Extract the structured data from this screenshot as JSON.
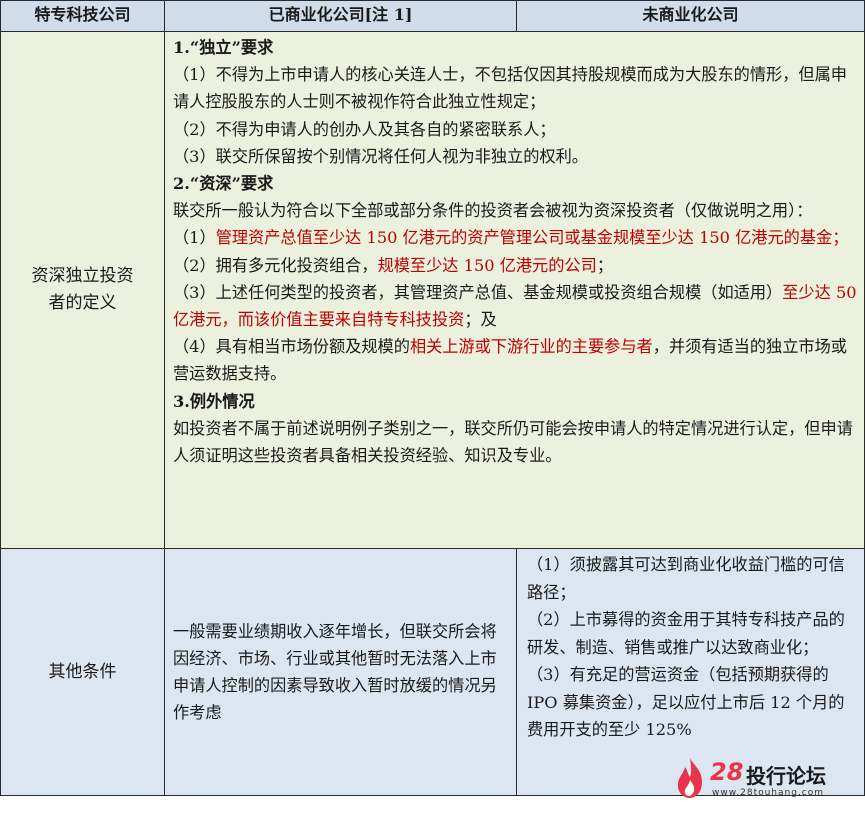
{
  "header": {
    "col1": "特专科技公司",
    "col2": "已商业化公司[注 1]",
    "col3": "未商业化公司"
  },
  "row1": {
    "label_l1": "资深独立投资",
    "label_l2": "者的定义",
    "s1_title": "1.“独立”要求",
    "s1_p1": "（1）不得为上市申请人的核心关连人士，不包括仅因其持股规模而成为大股东的情形，但属申请人控股股东的人士则不被视作符合此独立性规定；",
    "s1_p2": "（2）不得为申请人的创办人及其各自的紧密联系人；",
    "s1_p3": "（3）联交所保留按个别情况将任何人视为非独立的权利。",
    "s2_title": "2.“资深”要求",
    "s2_intro": "联交所一般认为符合以下全部或部分条件的投资者会被视为资深投资者（仅做说明之用）：",
    "s2_p1_pre": "（1）",
    "s2_p1_red": "管理资产总值至少达 150 亿港元的资产管理公司或基金规模至少达 150 亿港元的基金；",
    "s2_p2_pre": "（2）拥有多元化投资组合，",
    "s2_p2_red": "规模至少达 150 亿港元的公司",
    "s2_p2_post": "；",
    "s2_p3_pre": "（3）上述任何类型的投资者，其管理资产总值、基金规模或投资组合规模（如适用）",
    "s2_p3_red": "至少达 50 亿港元，而该价值主要来自特专科技投资",
    "s2_p3_post": "；及",
    "s2_p4_pre": "（4）具有相当市场份额及规模的",
    "s2_p4_red": "相关上游或下游行业的主要参与者",
    "s2_p4_post": "，并须有适当的独立市场或营运数据支持。",
    "s3_title": "3.例外情况",
    "s3_p1": "如投资者不属于前述说明例子类别之一，联交所仍可能会按申请人的特定情况进行认定，但申请人须证明这些投资者具备相关投资经验、知识及专业。"
  },
  "row2": {
    "label": "其他条件",
    "commercial": "一般需要业绩期收入逐年增长，但联交所会将因经济、市场、行业或其他暂时无法落入上市申请人控制的因素导致收入暂时放缓的情况另作考虑",
    "pre_p1": "（1）须披露其可达到商业化收益门槛的可信路径；",
    "pre_p2": "（2）上市募得的资金用于其特专科技产品的研发、制造、销售或推广以达致商业化；",
    "pre_p3": "（3）有充足的营运资金（包括预期获得的 IPO 募集资金），足以应付上市后 12 个月的费用开支的至少 125%"
  },
  "watermark": {
    "num": "28",
    "name": "投行论坛",
    "url": "www.28touhang.com"
  }
}
